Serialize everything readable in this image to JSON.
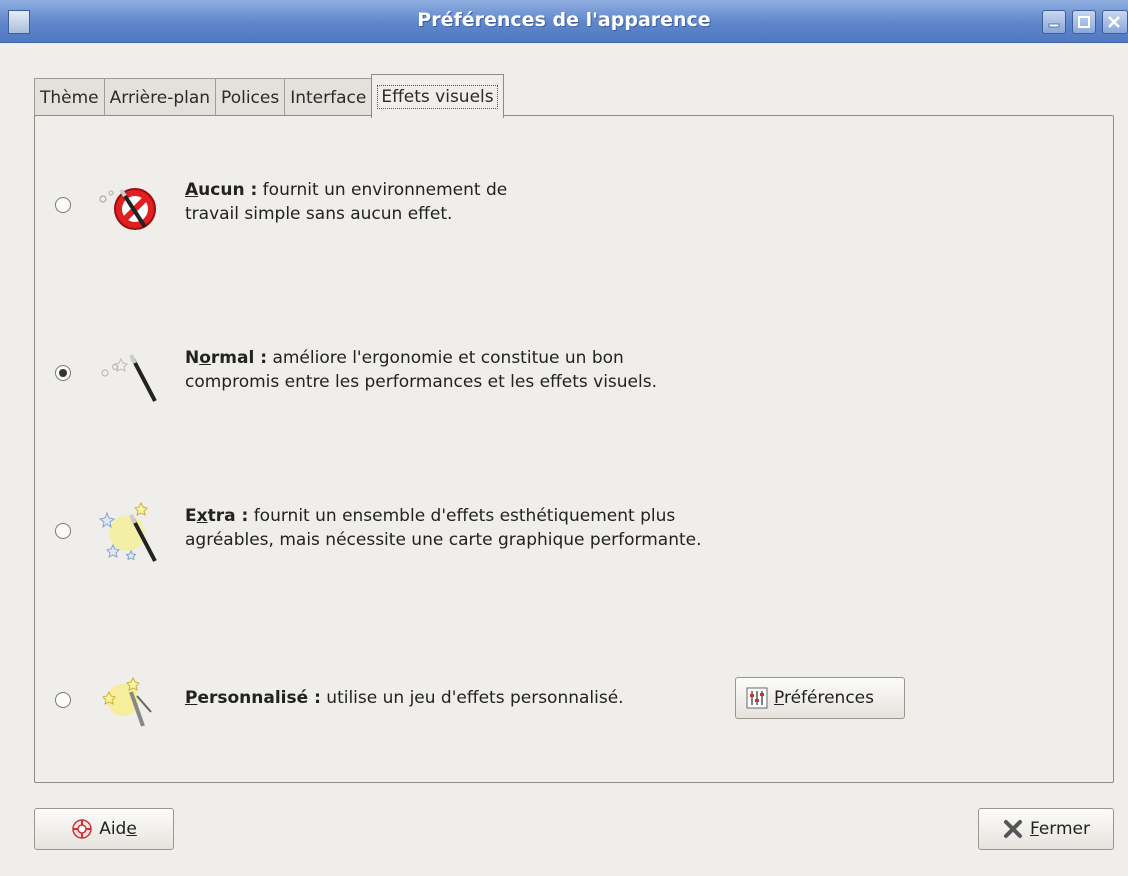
{
  "window": {
    "title": "Préférences de l'apparence"
  },
  "tabs": [
    {
      "label": "Thème"
    },
    {
      "label": "Arrière-plan"
    },
    {
      "label": "Polices"
    },
    {
      "label": "Interface"
    },
    {
      "label": "Effets visuels",
      "selected": true
    }
  ],
  "options": [
    {
      "title_underline": "A",
      "title_rest": "ucun :",
      "line1": " fournit un environnement de",
      "line2": "travail simple sans aucun effet.",
      "selected": false,
      "icon": "no-effects-icon"
    },
    {
      "title_pre": "N",
      "title_underline": "o",
      "title_rest": "rmal :",
      "line1": " améliore l'ergonomie et constitue un bon",
      "line2": "compromis entre les performances et les effets visuels.",
      "selected": true,
      "icon": "magic-wand-icon"
    },
    {
      "title_pre": "E",
      "title_underline": "x",
      "title_rest": "tra :",
      "line1": " fournit un ensemble d'effets esthétiquement plus",
      "line2": "agréables, mais nécessite une carte graphique performante.",
      "selected": false,
      "icon": "sparkle-wand-icon"
    },
    {
      "title_underline": "P",
      "title_rest": "ersonnalisé :",
      "line1": " utilise un jeu d'effets personnalisé.",
      "selected": false,
      "icon": "custom-effects-icon"
    }
  ],
  "buttons": {
    "preferences_underline": "P",
    "preferences_rest": "références",
    "help_pre": "Aid",
    "help_underline": "e",
    "close_underline": "F",
    "close_rest": "ermer"
  },
  "colors": {
    "titlebar": "#5f86cc",
    "background": "#f0eeea"
  }
}
